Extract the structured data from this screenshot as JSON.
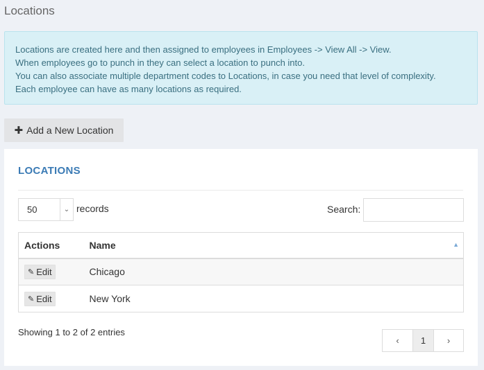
{
  "page": {
    "title": "Locations"
  },
  "info": {
    "lines": [
      "Locations are created here and then assigned to employees in Employees -> View All -> View.",
      "When employees go to punch in they can select a location to punch into.",
      "You can also associate multiple department codes to Locations, in case you need that level of complexity.",
      "Each employee can have as many locations as required."
    ]
  },
  "toolbar": {
    "add_label": "Add a New Location",
    "add_icon": "plus-icon"
  },
  "card": {
    "title": "LOCATIONS"
  },
  "table_controls": {
    "length_value": "50",
    "records_label": "records",
    "search_label": "Search:",
    "search_value": ""
  },
  "table": {
    "columns": [
      "Actions",
      "Name"
    ],
    "rows": [
      {
        "action": "Edit",
        "name": "Chicago"
      },
      {
        "action": "Edit",
        "name": "New York"
      }
    ]
  },
  "footer": {
    "info": "Showing 1 to 2 of 2 entries",
    "prev": "‹",
    "page": "1",
    "next": "›"
  }
}
